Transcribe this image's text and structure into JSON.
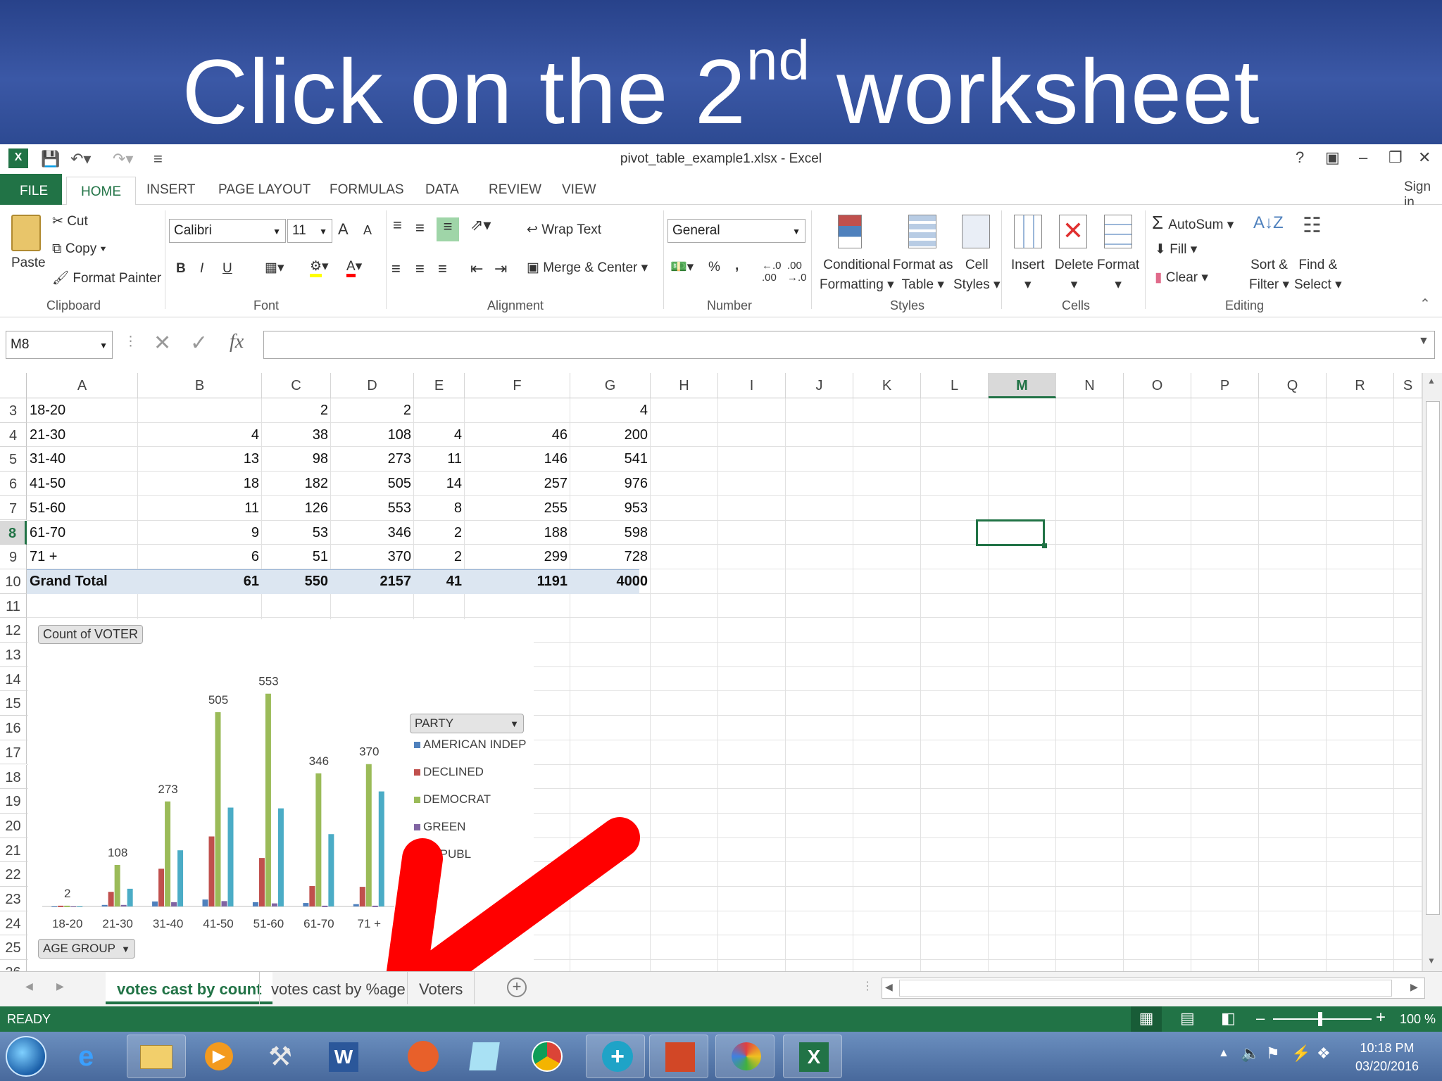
{
  "banner": {
    "prefix": "Click on the 2",
    "sup": "nd",
    "suffix": " worksheet"
  },
  "window": {
    "title": "pivot_table_example1.xlsx - Excel",
    "help": "?",
    "sign_in": "Sign in"
  },
  "tabs": [
    "FILE",
    "HOME",
    "INSERT",
    "PAGE LAYOUT",
    "FORMULAS",
    "DATA",
    "REVIEW",
    "VIEW"
  ],
  "ribbon": {
    "clipboard": {
      "paste": "Paste",
      "cut": "Cut",
      "copy": "Copy",
      "format_painter": "Format Painter",
      "label": "Clipboard"
    },
    "font": {
      "name": "Calibri",
      "size": "11",
      "bold": "B",
      "italic": "I",
      "underline": "U",
      "grow": "A",
      "shrink": "A",
      "label": "Font"
    },
    "alignment": {
      "wrap": "Wrap Text",
      "merge": "Merge & Center",
      "label": "Alignment"
    },
    "number": {
      "format": "General",
      "percent": "%",
      "comma": ",",
      "label": "Number"
    },
    "styles": {
      "conditional": "Conditional",
      "conditional2": "Formatting",
      "format_table": "Format as",
      "format_table2": "Table",
      "cell_styles": "Cell",
      "cell_styles2": "Styles",
      "label": "Styles"
    },
    "cells": {
      "insert": "Insert",
      "delete": "Delete",
      "format": "Format",
      "label": "Cells"
    },
    "editing": {
      "autosum": "AutoSum",
      "fill": "Fill",
      "clear": "Clear",
      "sort": "Sort &",
      "sort2": "Filter",
      "find": "Find &",
      "find2": "Select",
      "label": "Editing"
    }
  },
  "formula_bar": {
    "name_box": "M8",
    "fx": "fx",
    "value": ""
  },
  "columns": [
    "A",
    "B",
    "C",
    "D",
    "E",
    "F",
    "G",
    "H",
    "I",
    "J",
    "K",
    "L",
    "M",
    "N",
    "O",
    "P",
    "Q",
    "R",
    "S"
  ],
  "rows": [
    "3",
    "4",
    "5",
    "6",
    "7",
    "8",
    "9",
    "10",
    "11",
    "12",
    "13",
    "14",
    "15",
    "16",
    "17",
    "18",
    "19",
    "20",
    "21",
    "22",
    "23",
    "24",
    "25",
    "26"
  ],
  "table": [
    [
      "18-20",
      "",
      "2",
      "2",
      "",
      "",
      "4"
    ],
    [
      "21-30",
      "4",
      "38",
      "108",
      "4",
      "46",
      "200"
    ],
    [
      "31-40",
      "13",
      "98",
      "273",
      "11",
      "146",
      "541"
    ],
    [
      "41-50",
      "18",
      "182",
      "505",
      "14",
      "257",
      "976"
    ],
    [
      "51-60",
      "11",
      "126",
      "553",
      "8",
      "255",
      "953"
    ],
    [
      "61-70",
      "9",
      "53",
      "346",
      "2",
      "188",
      "598"
    ],
    [
      "71 +",
      "6",
      "51",
      "370",
      "2",
      "299",
      "728"
    ],
    [
      "Grand Total",
      "61",
      "550",
      "2157",
      "41",
      "1191",
      "4000"
    ]
  ],
  "chart": {
    "field_button": "Count of VOTER",
    "legend_button": "PARTY",
    "axis_button": "AGE GROUP"
  },
  "chart_data": {
    "type": "bar",
    "categories": [
      "18-20",
      "21-30",
      "31-40",
      "41-50",
      "51-60",
      "61-70",
      "71 +"
    ],
    "series": [
      {
        "name": "AMERICAN INDEP",
        "color": "#4f81bd",
        "values": [
          0,
          4,
          13,
          18,
          11,
          9,
          6
        ]
      },
      {
        "name": "DECLINED",
        "color": "#c0504d",
        "values": [
          2,
          38,
          98,
          182,
          126,
          53,
          51
        ]
      },
      {
        "name": "DEMOCRAT",
        "color": "#9bbb59",
        "values": [
          2,
          108,
          273,
          505,
          553,
          346,
          370
        ]
      },
      {
        "name": "GREEN",
        "color": "#8064a2",
        "values": [
          0,
          4,
          11,
          14,
          8,
          2,
          2
        ]
      },
      {
        "name": "REPUBL",
        "color": "#4bacc6",
        "values": [
          0,
          46,
          146,
          257,
          255,
          188,
          299
        ]
      }
    ],
    "data_labels": {
      "series": "DEMOCRAT",
      "values": [
        "2",
        "108",
        "273",
        "505",
        "553",
        "346",
        "370"
      ]
    },
    "ylim": [
      0,
      600
    ],
    "legend": "right"
  },
  "sheets": [
    "votes cast by count",
    "votes cast by %age",
    "Voters"
  ],
  "status": {
    "ready": "READY",
    "zoom": "100 %"
  },
  "taskbar": {
    "time": "10:18 PM",
    "date": "03/20/2016"
  },
  "colors": {
    "excel_green": "#217346",
    "arrow_red": "#ff0000",
    "banner_blue": "#2f4c98"
  }
}
